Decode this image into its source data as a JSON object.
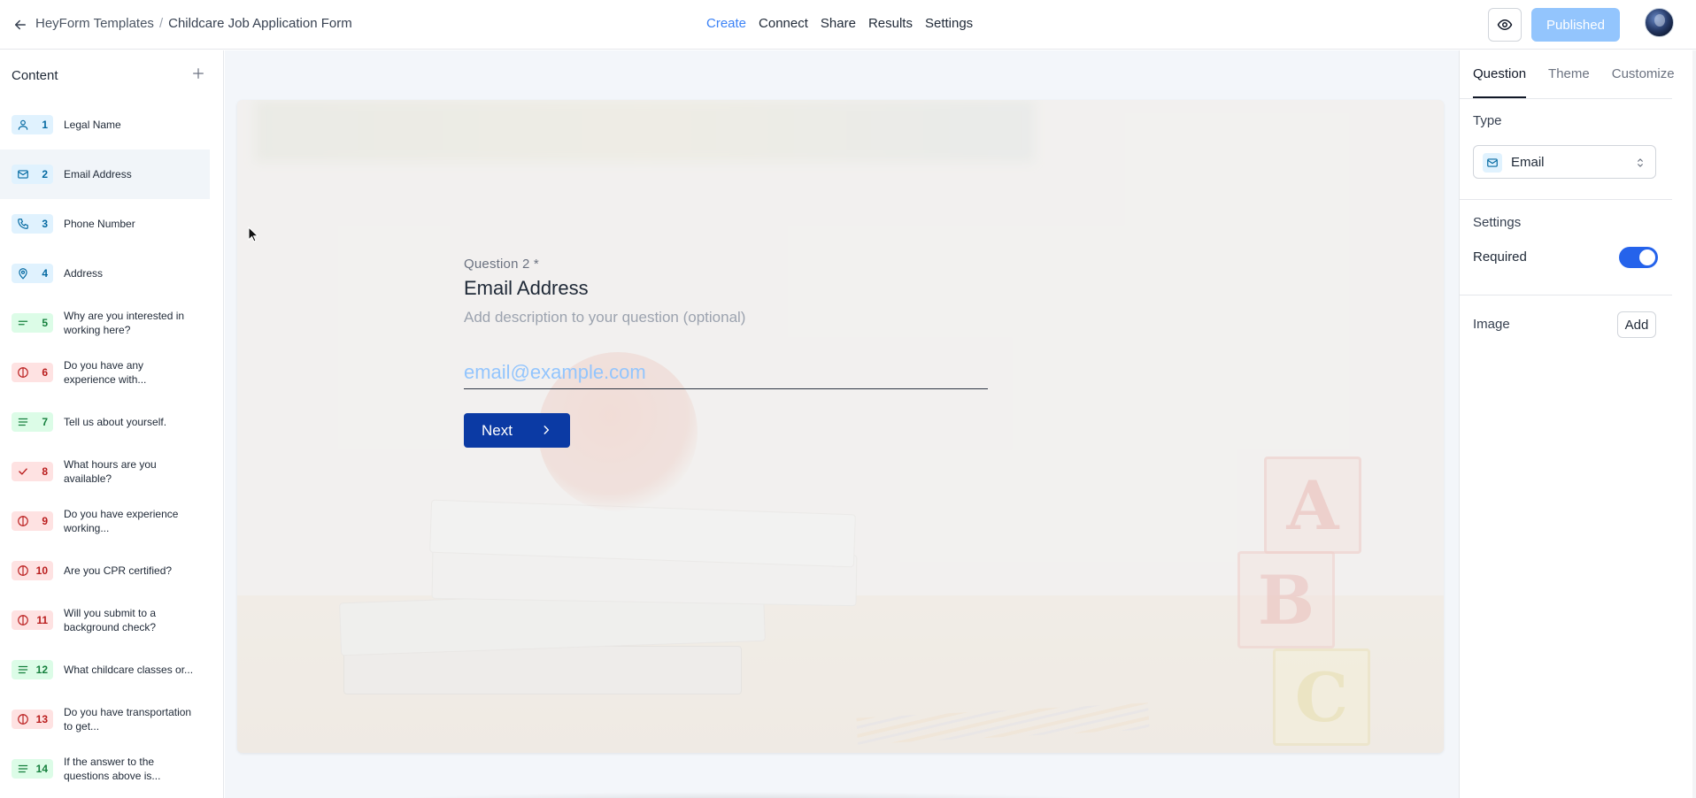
{
  "header": {
    "back_icon": "arrow-left-icon",
    "breadcrumb_parent": "HeyForm Templates",
    "breadcrumb_separator": "/",
    "breadcrumb_current": "Childcare Job Application Form",
    "nav": [
      {
        "label": "Create",
        "active": true
      },
      {
        "label": "Connect",
        "active": false
      },
      {
        "label": "Share",
        "active": false
      },
      {
        "label": "Results",
        "active": false
      },
      {
        "label": "Settings",
        "active": false
      }
    ],
    "preview_icon": "eye-icon",
    "publish_label": "Published",
    "accent_color": "#3b82f6"
  },
  "sidebar": {
    "title": "Content",
    "add_icon": "plus-icon",
    "items": [
      {
        "num": "1",
        "label": "Legal Name",
        "icon": "user-icon",
        "color": "blue"
      },
      {
        "num": "2",
        "label": "Email Address",
        "icon": "mail-icon",
        "color": "blue",
        "active": true
      },
      {
        "num": "3",
        "label": "Phone Number",
        "icon": "phone-icon",
        "color": "blue"
      },
      {
        "num": "4",
        "label": "Address",
        "icon": "map-pin-icon",
        "color": "blue"
      },
      {
        "num": "5",
        "label": "Why are you interested in working here?",
        "icon": "short-text-icon",
        "color": "green"
      },
      {
        "num": "6",
        "label": "Do you have any experience with...",
        "icon": "yes-no-icon",
        "color": "red"
      },
      {
        "num": "7",
        "label": "Tell us about yourself.",
        "icon": "long-text-icon",
        "color": "green"
      },
      {
        "num": "8",
        "label": "What hours are you available?",
        "icon": "checkmark-icon",
        "color": "red"
      },
      {
        "num": "9",
        "label": "Do you have experience working...",
        "icon": "yes-no-icon",
        "color": "red"
      },
      {
        "num": "10",
        "label": "Are you CPR certified?",
        "icon": "yes-no-icon",
        "color": "red"
      },
      {
        "num": "11",
        "label": "Will you submit to a background check?",
        "icon": "yes-no-icon",
        "color": "red"
      },
      {
        "num": "12",
        "label": "What childcare classes or...",
        "icon": "long-text-icon",
        "color": "green"
      },
      {
        "num": "13",
        "label": "Do you have transportation to get...",
        "icon": "yes-no-icon",
        "color": "red"
      },
      {
        "num": "14",
        "label": "If the answer to the questions above is...",
        "icon": "long-text-icon",
        "color": "green"
      }
    ]
  },
  "canvas": {
    "question_number": "Question 2 *",
    "question_title": "Email Address",
    "question_description": "Add description to your question (optional)",
    "input_placeholder": "email@example.com",
    "next_label": "Next",
    "block_letters": [
      "A",
      "B",
      "C"
    ]
  },
  "right_panel": {
    "tabs": [
      {
        "label": "Question",
        "active": true
      },
      {
        "label": "Theme",
        "active": false
      },
      {
        "label": "Customize",
        "active": false
      }
    ],
    "type_label": "Type",
    "type_value": "Email",
    "settings_label": "Settings",
    "required_label": "Required",
    "required_on": true,
    "image_label": "Image",
    "add_label": "Add"
  }
}
